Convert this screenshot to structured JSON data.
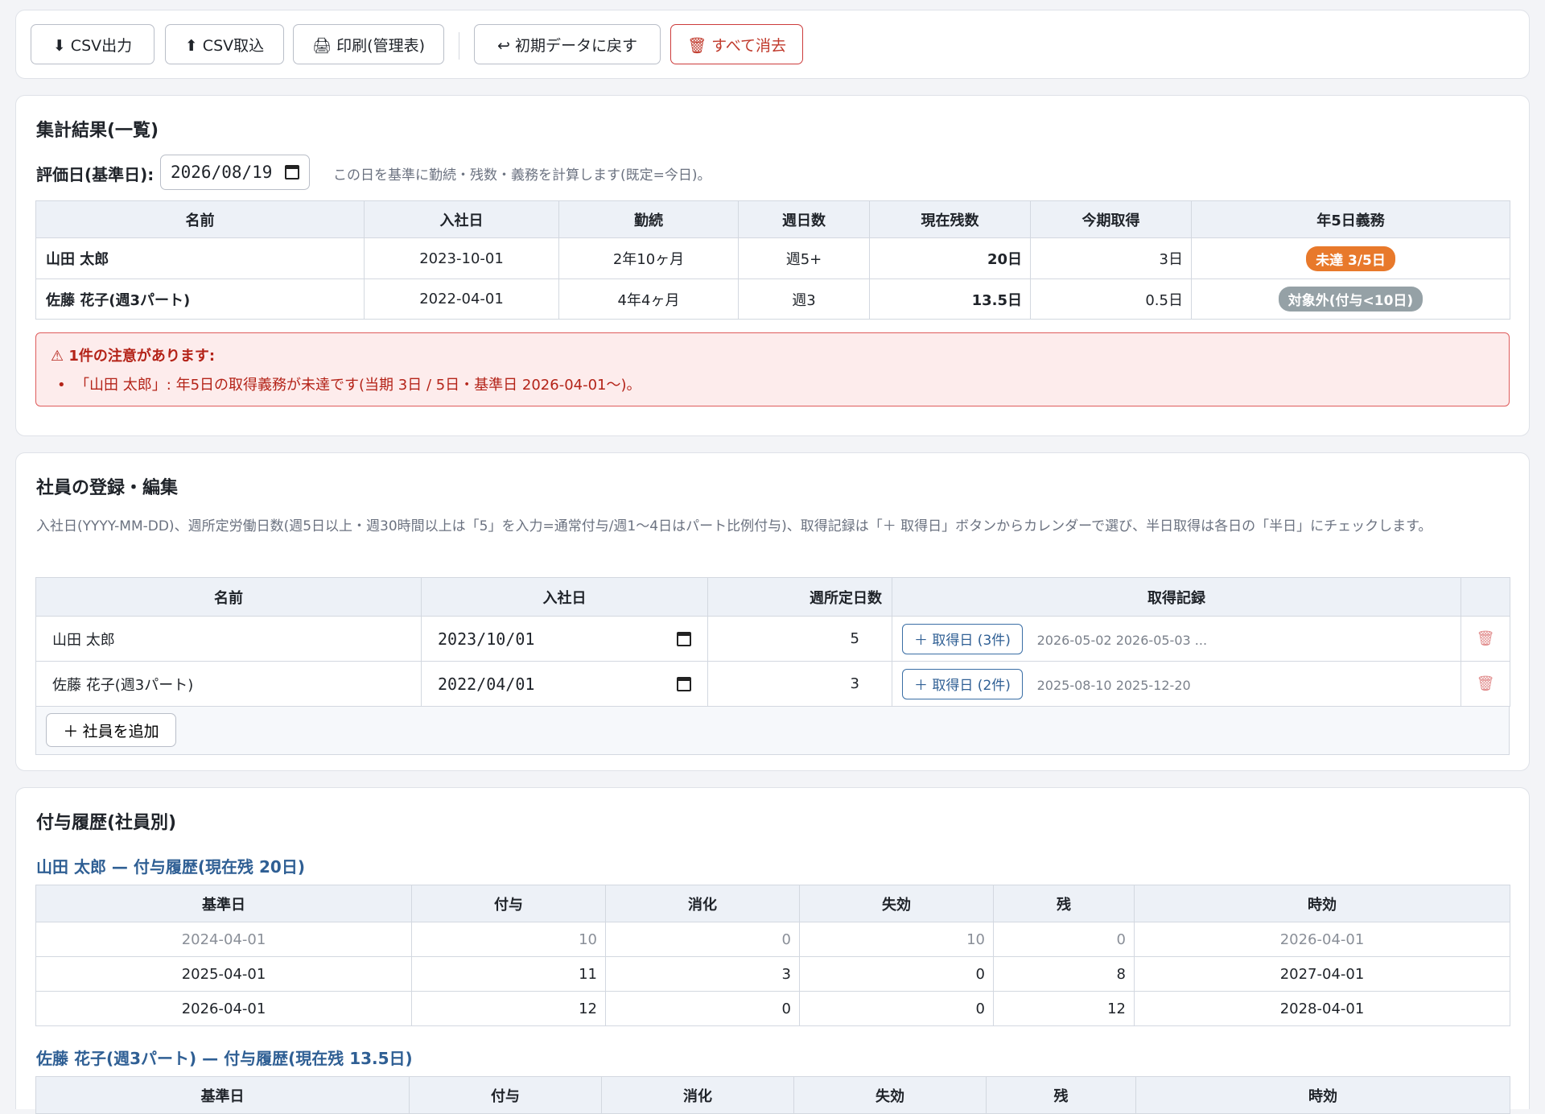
{
  "toolbar": {
    "csv_export": "⬇ CSV出力",
    "csv_import": "⬆ CSV取込",
    "print": "🖨 印刷(管理表)",
    "reset": "↩ 初期データに戻す",
    "clear_all": "🗑 すべて消去"
  },
  "summary": {
    "title": "集計結果(一覧)",
    "eval_label": "評価日(基準日):",
    "eval_date": "2026/08/19",
    "eval_hint": "この日を基準に勤続・残数・義務を計算します(既定=今日)。",
    "headers": [
      "名前",
      "入社日",
      "勤続",
      "週日数",
      "現在残数",
      "今期取得",
      "年5日義務"
    ],
    "rows": [
      {
        "name": "山田 太郎",
        "hire": "2023-10-01",
        "tenure": "2年10ヶ月",
        "week": "週5+",
        "remain": "20日",
        "taken": "3日",
        "duty": "未達 3/5日"
      },
      {
        "name": "佐藤 花子(週3パート)",
        "hire": "2022-04-01",
        "tenure": "4年4ヶ月",
        "week": "週3",
        "remain": "13.5日",
        "taken": "0.5日",
        "duty": "対象外(付与<10日)"
      }
    ],
    "alert_title": "⚠ 1件の注意があります:",
    "alert_item": "「山田 太郎」: 年5日の取得義務が未達です(当期 3日 / 5日・基準日 2026-04-01〜)。"
  },
  "employees": {
    "title": "社員の登録・編集",
    "desc": "入社日(YYYY-MM-DD)、週所定労働日数(週5日以上・週30時間以上は「5」を入力=通常付与/週1〜4日はパート比例付与)、取得記録は「＋ 取得日」ボタンからカレンダーで選び、半日取得は各日の「半日」にチェックします。",
    "headers": [
      "名前",
      "入社日",
      "週所定日数",
      "取得記録",
      ""
    ],
    "rows": [
      {
        "name": "山田 太郎",
        "hire": "2023/10/01",
        "days": "5",
        "btn": "＋ 取得日 (3件)",
        "dates": "2026-05-02 2026-05-03 ..."
      },
      {
        "name": "佐藤 花子(週3パート)",
        "hire": "2022/04/01",
        "days": "3",
        "btn": "＋ 取得日 (2件)",
        "dates": "2025-08-10 2025-12-20"
      }
    ],
    "add_btn": "＋ 社員を追加"
  },
  "history": {
    "title": "付与履歴(社員別)",
    "headers": [
      "基準日",
      "付与",
      "消化",
      "失効",
      "残",
      "時効"
    ],
    "sections": [
      {
        "title": "山田 太郎 — 付与履歴(現在残 20日)",
        "rows": [
          [
            "2024-04-01",
            "10",
            "0",
            "10",
            "0",
            "2026-04-01"
          ],
          [
            "2025-04-01",
            "11",
            "3",
            "0",
            "8",
            "2027-04-01"
          ],
          [
            "2026-04-01",
            "12",
            "0",
            "0",
            "12",
            "2028-04-01"
          ]
        ]
      },
      {
        "title": "佐藤 花子(週3パート) — 付与履歴(現在残 13.5日)"
      }
    ]
  },
  "colors": {
    "accent": "#2f5f94",
    "danger": "#c0392b",
    "badge_warn": "#e8792b",
    "badge_neutral": "#95a1a6"
  }
}
